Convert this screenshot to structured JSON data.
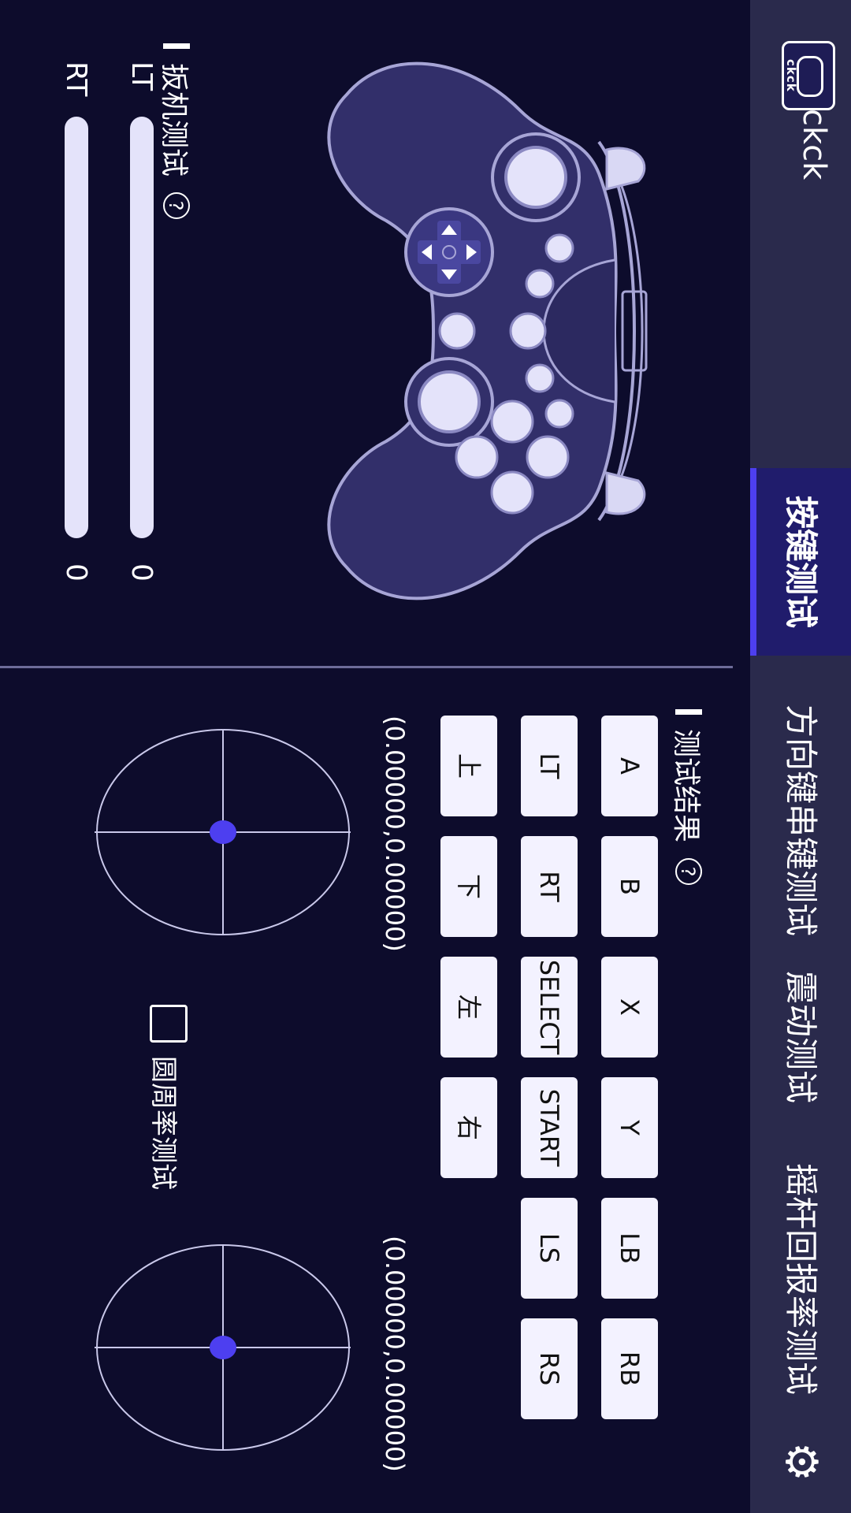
{
  "header": {
    "brand": "ckck",
    "logo_text": "ckck",
    "tabs": [
      {
        "label": "按键测试",
        "active": true
      },
      {
        "label": "方向键串键测试",
        "active": false
      },
      {
        "label": "震动测试",
        "active": false
      },
      {
        "label": "摇杆回报率测试",
        "active": false
      }
    ],
    "settings_icon": "gear-icon"
  },
  "trigger": {
    "title": "扳机测试",
    "help": "?",
    "lt_label": "LT",
    "rt_label": "RT",
    "lt_value": "0",
    "rt_value": "0"
  },
  "results": {
    "title": "测试结果",
    "help": "?",
    "buttons": [
      "A",
      "B",
      "X",
      "Y",
      "LB",
      "RB",
      "LT",
      "RT",
      "SELECT",
      "START",
      "LS",
      "RS",
      "上",
      "下",
      "左",
      "右"
    ]
  },
  "sticks": {
    "left_coord": "(0.00000,0.00000)",
    "right_coord": "(0.00000,0.00000)"
  },
  "circle_test": {
    "label": "圆周率测试",
    "checked": false
  },
  "colors": {
    "background": "#0d0c2c",
    "nav": "#2a2a4c",
    "accent": "#4d3ff0",
    "controller": "#322f6a"
  }
}
